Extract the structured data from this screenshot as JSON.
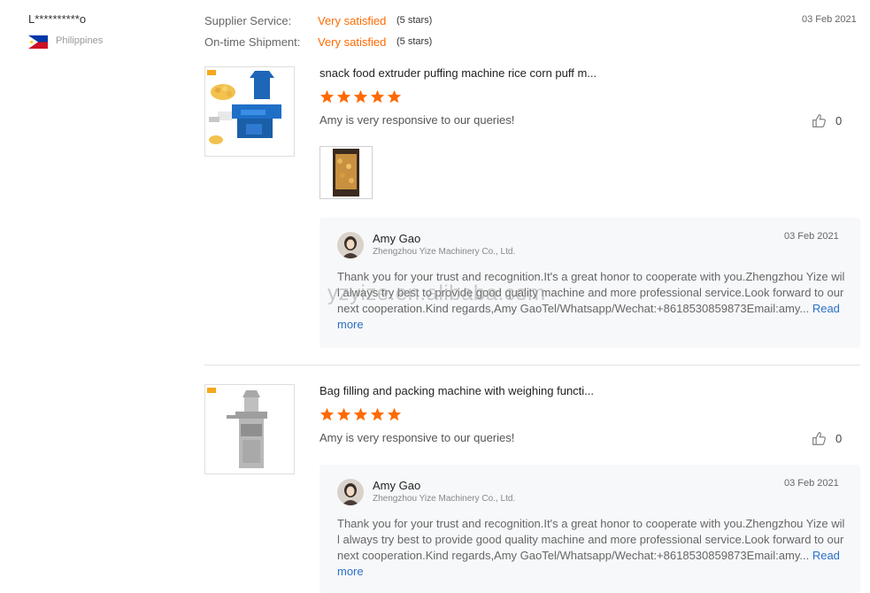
{
  "reviewer": {
    "name": "L**********o",
    "country": "Philippines"
  },
  "summary": {
    "supplier_service_label": "Supplier Service:",
    "supplier_service_value": "Very satisfied",
    "supplier_service_stars": "(5 stars)",
    "shipment_label": "On-time Shipment:",
    "shipment_value": "Very satisfied",
    "shipment_stars": "(5 stars)",
    "date": "03 Feb 2021"
  },
  "reviews": [
    {
      "title": "snack food extruder puffing machine rice corn puff m...",
      "rating": 5,
      "comment": "Amy is very responsive to our queries!",
      "likes": "0",
      "reply": {
        "name": "Amy Gao",
        "company": "Zhengzhou Yize Machinery Co., Ltd.",
        "date": "03 Feb 2021",
        "text": "Thank you for your trust and recognition.It's a great honor to cooperate with you.Zhengzhou Yize will always try best to provide good quality machine and more professional service.Look forward to our next cooperation.Kind regards,Amy GaoTel/Whatsapp/Wechat:+8618530859873Email:amy...",
        "read_more": "Read more"
      }
    },
    {
      "title": "Bag filling and packing machine with weighing functi...",
      "rating": 5,
      "comment": "Amy is very responsive to our queries!",
      "likes": "0",
      "reply": {
        "name": "Amy Gao",
        "company": "Zhengzhou Yize Machinery Co., Ltd.",
        "date": "03 Feb 2021",
        "text": "Thank you for your trust and recognition.It's a great honor to cooperate with you.Zhengzhou Yize will always try best to provide good quality machine and more professional service.Look forward to our next cooperation.Kind regards,Amy GaoTel/Whatsapp/Wechat:+8618530859873Email:amy...",
        "read_more": "Read more"
      }
    }
  ],
  "watermark": "yzyize.en.alibaba.com",
  "colors": {
    "accent": "#ff6a00",
    "link": "#2b70c4"
  }
}
